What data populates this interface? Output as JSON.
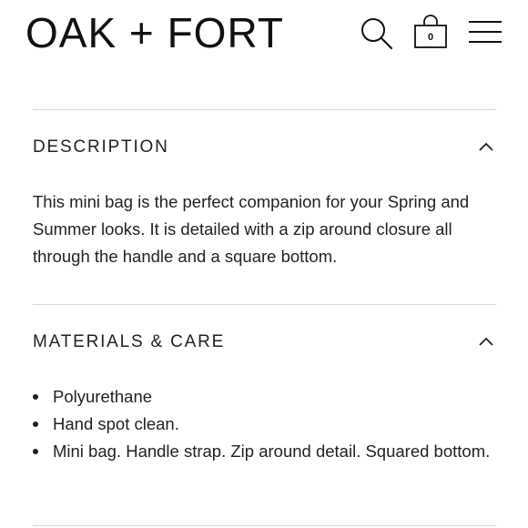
{
  "header": {
    "logo": "OAK + FORT",
    "cart_count": "0",
    "icons": [
      "search-icon",
      "shopping-bag-icon",
      "hamburger-menu-icon"
    ]
  },
  "sections": [
    {
      "title": "DESCRIPTION",
      "expanded": true,
      "body": "This mini bag is the perfect companion for your Spring and Summer looks. It is detailed with a zip around closure all through the handle and a square bottom."
    },
    {
      "title": "MATERIALS & CARE",
      "expanded": true,
      "items": [
        "Polyurethane",
        "Hand spot clean.",
        "Mini bag. Handle strap. Zip around detail. Squared bottom."
      ]
    }
  ],
  "colors": {
    "text": "#222222",
    "divider": "#d6d6d6",
    "background": "#ffffff"
  }
}
